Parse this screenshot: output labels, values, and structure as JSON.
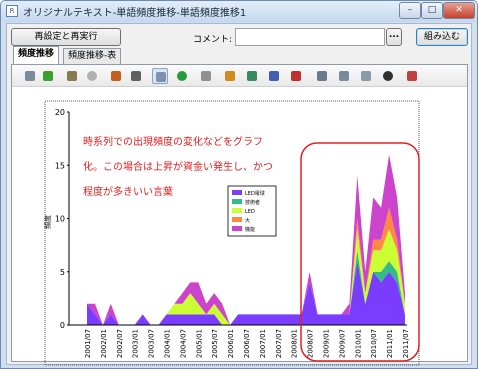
{
  "window": {
    "title": "オリジナルテキスト-単語頻度推移-単語頻度推移1",
    "icon_label": "R",
    "min_glyph": "–",
    "max_glyph": "□",
    "close_glyph": "✕"
  },
  "controls": {
    "recompute_label": "再設定と再実行",
    "comment_label": "コメント:",
    "comment_value": "",
    "more_label": "...",
    "embed_label": "組み込む"
  },
  "tabs": [
    {
      "label": "頻度推移",
      "active": true
    },
    {
      "label": "頻度推移-表",
      "active": false
    }
  ],
  "toolbar": {
    "tools": [
      {
        "name": "grid-icon",
        "color": "#7a8a9a"
      },
      {
        "name": "refresh-icon",
        "color": "#3aa030"
      },
      {
        "name": "zoom-icon",
        "color": "#8a7a50"
      },
      {
        "name": "circle-icon",
        "color": "#b0b0b0"
      },
      {
        "name": "home-icon",
        "color": "#c06020"
      },
      {
        "name": "pointer-icon",
        "color": "#606060"
      },
      {
        "name": "draw-icon",
        "color": "#8090b0",
        "pressed": true
      },
      {
        "name": "add-icon",
        "color": "#2a9a3a"
      },
      {
        "name": "list-icon",
        "color": "#909090"
      },
      {
        "name": "axis-a-icon",
        "color": "#d08a20"
      },
      {
        "name": "axis-b-icon",
        "color": "#3a8a60"
      },
      {
        "name": "axis-c-icon",
        "color": "#4060b0"
      },
      {
        "name": "text-icon",
        "color": "#c03030"
      },
      {
        "name": "bar-chart-icon",
        "color": "#6a7a8a"
      },
      {
        "name": "legend-icon",
        "color": "#7a8a9a"
      },
      {
        "name": "image-icon",
        "color": "#8a9aa8"
      },
      {
        "name": "pie-icon",
        "color": "#303030"
      },
      {
        "name": "tools-icon",
        "color": "#c04040"
      }
    ]
  },
  "annotation": {
    "lines": [
      "時系列での出現頻度の変化などをグラフ",
      "化。この場合は上昇が資金い発生し、かつ",
      "程度が多きいい言葉"
    ],
    "color": "#e02020"
  },
  "highlight": {
    "color": "#e02020"
  },
  "chart_data": {
    "type": "area",
    "stacked": true,
    "ylabel": "頻度",
    "ylim": [
      0,
      20
    ],
    "yticks": [
      0,
      5,
      10,
      15,
      20
    ],
    "x": [
      "2001/07",
      "2001/10",
      "2002/01",
      "2002/04",
      "2002/07",
      "2002/10",
      "2003/01",
      "2003/04",
      "2003/07",
      "2003/10",
      "2004/01",
      "2004/04",
      "2004/07",
      "2004/10",
      "2005/01",
      "2005/04",
      "2005/07",
      "2005/10",
      "2006/01",
      "2006/04",
      "2006/07",
      "2006/10",
      "2007/01",
      "2007/04",
      "2007/07",
      "2007/10",
      "2008/01",
      "2008/04",
      "2008/07",
      "2008/10",
      "2009/01",
      "2009/04",
      "2009/07",
      "2009/10",
      "2010/01",
      "2010/04",
      "2010/07",
      "2010/10",
      "2011/01",
      "2011/04",
      "2011/07"
    ],
    "xticks": [
      "2001/07",
      "2002/01",
      "2002/07",
      "2003/01",
      "2003/07",
      "2004/01",
      "2004/07",
      "2005/01",
      "2005/07",
      "2006/01",
      "2006/07",
      "2007/01",
      "2007/07",
      "2008/01",
      "2008/07",
      "2009/01",
      "2009/07",
      "2010/01",
      "2010/07",
      "2011/01",
      "2011/07"
    ],
    "series": [
      {
        "name": "LED電球",
        "color": "#7a3cff",
        "values": [
          2,
          1,
          0,
          1,
          0,
          0,
          0,
          1,
          0,
          0,
          1,
          1,
          1,
          1,
          1,
          1,
          1,
          0,
          0,
          1,
          1,
          1,
          1,
          1,
          1,
          1,
          1,
          1,
          4,
          1,
          1,
          1,
          1,
          1,
          6,
          2,
          5,
          4,
          5,
          4,
          1
        ]
      },
      {
        "name": "技術者",
        "color": "#33bb88",
        "values": [
          0,
          0,
          0,
          0,
          0,
          0,
          0,
          0,
          0,
          0,
          0,
          0,
          0,
          0,
          0,
          0,
          0,
          0,
          0,
          0,
          0,
          0,
          0,
          0,
          0,
          0,
          0,
          0,
          0,
          0,
          0,
          0,
          0,
          0,
          1,
          0,
          0,
          1,
          1,
          1,
          0
        ]
      },
      {
        "name": "LED",
        "color": "#ccff33",
        "values": [
          0,
          0,
          0,
          0,
          0,
          0,
          0,
          0,
          0,
          0,
          0,
          1,
          1,
          2,
          1,
          0,
          1,
          1,
          0,
          0,
          0,
          0,
          0,
          0,
          0,
          0,
          0,
          0,
          0,
          0,
          0,
          0,
          0,
          0,
          2,
          1,
          2,
          2,
          3,
          2,
          1
        ]
      },
      {
        "name": "大",
        "color": "#ff8844",
        "values": [
          0,
          0,
          0,
          0,
          0,
          0,
          0,
          0,
          0,
          0,
          0,
          0,
          0,
          0,
          0,
          0,
          0,
          0,
          0,
          0,
          0,
          0,
          0,
          0,
          0,
          0,
          0,
          0,
          0,
          0,
          0,
          0,
          0,
          0,
          1,
          0,
          1,
          1,
          2,
          1,
          0
        ]
      },
      {
        "name": "機能",
        "color": "#cc44cc",
        "values": [
          0,
          1,
          0,
          1,
          0,
          0,
          0,
          0,
          0,
          0,
          0,
          0,
          1,
          1,
          2,
          1,
          1,
          1,
          0,
          0,
          0,
          0,
          0,
          0,
          0,
          0,
          0,
          0,
          1,
          0,
          0,
          0,
          0,
          1,
          4,
          2,
          4,
          3,
          5,
          4,
          1
        ]
      }
    ],
    "legend_position": "center"
  }
}
